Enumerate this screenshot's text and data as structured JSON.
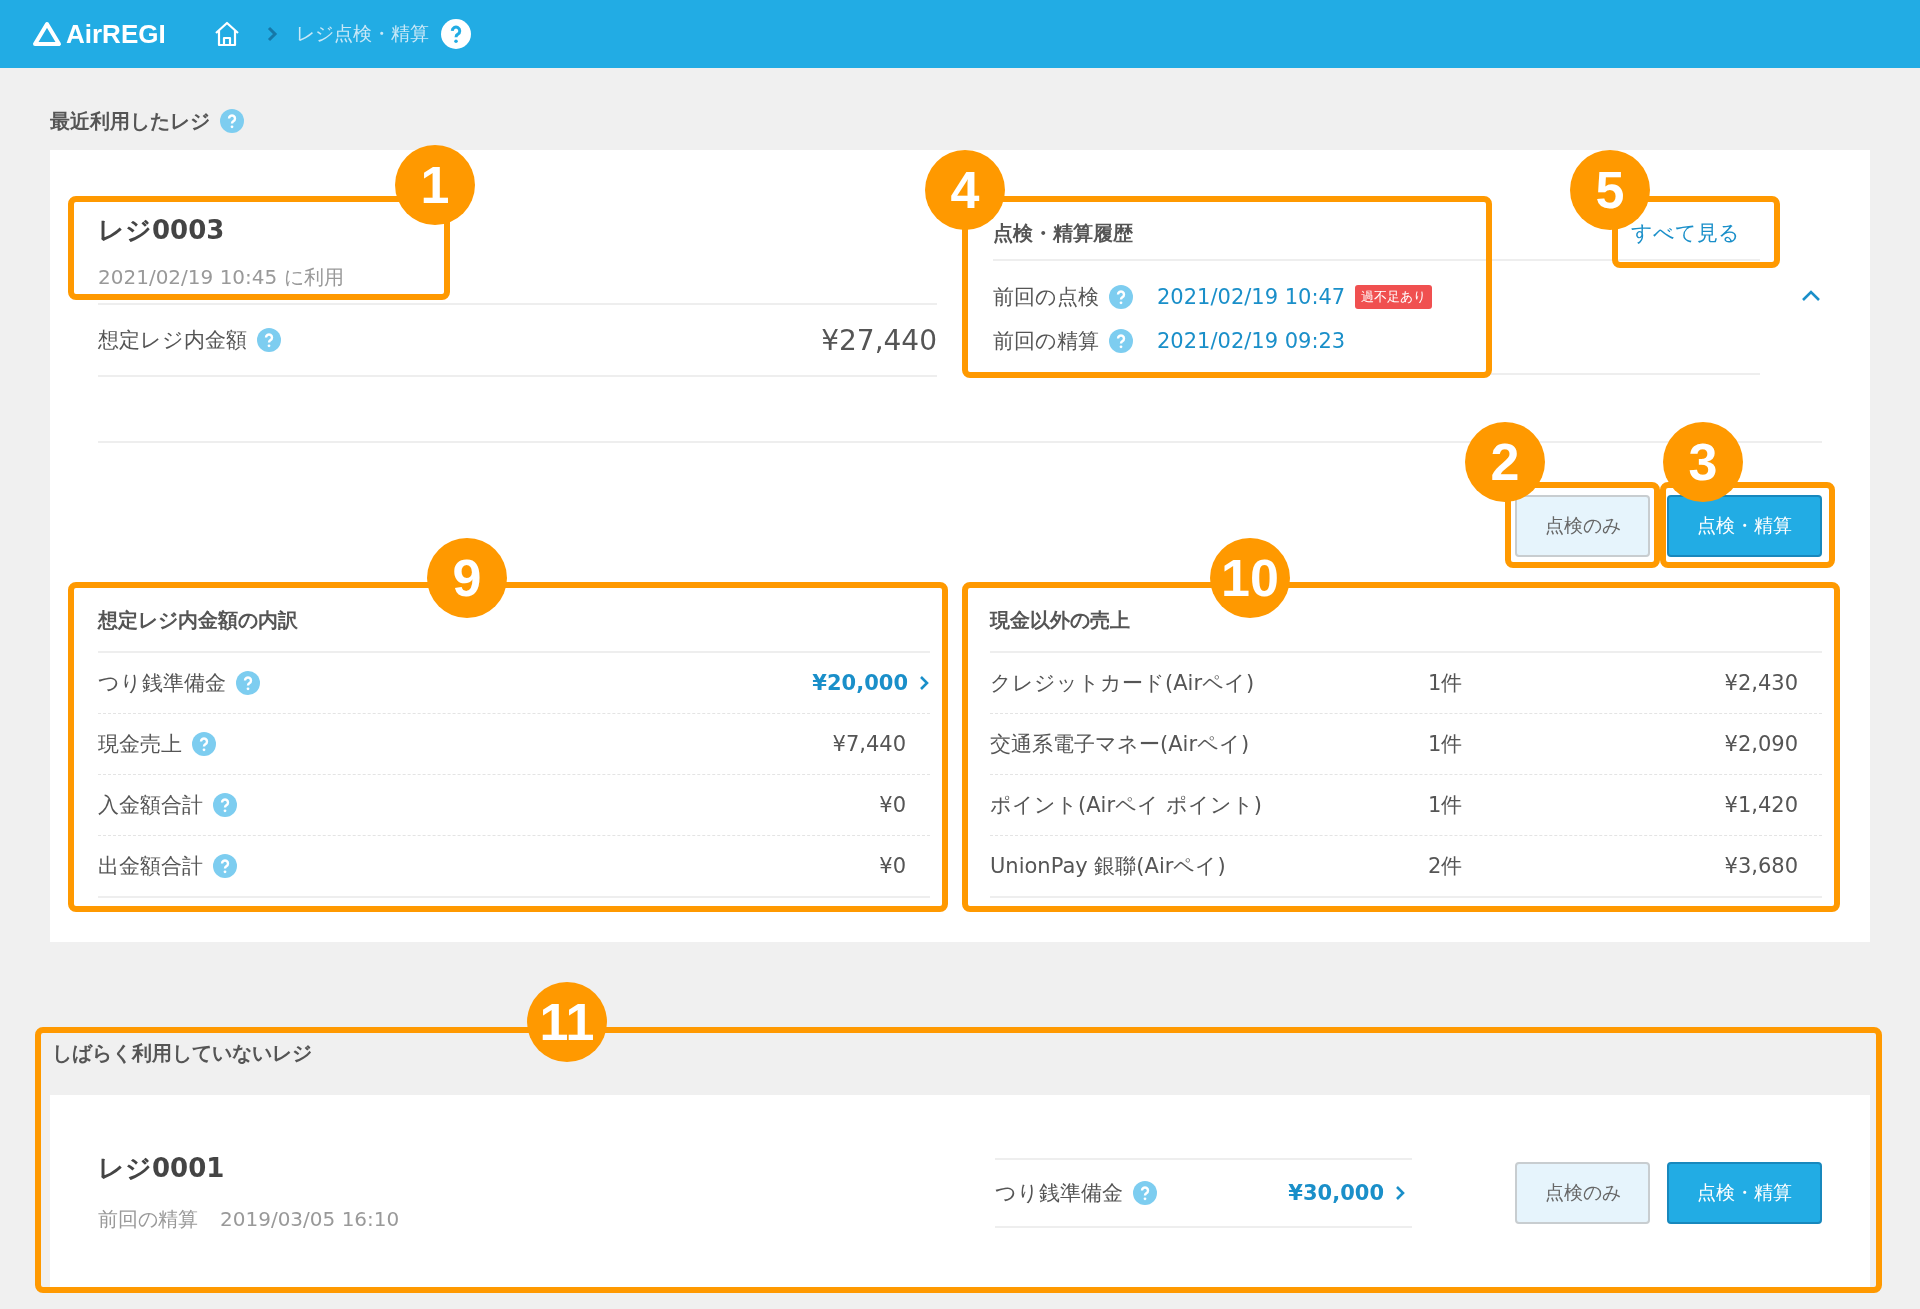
{
  "header": {
    "logo": "AirREGI",
    "breadcrumb": "レジ点検・精算"
  },
  "recent": {
    "title": "最近利用したレジ",
    "register": {
      "name": "レジ0003",
      "used_at": "2021/02/19 10:45 に利用",
      "expected_label": "想定レジ内金額",
      "expected_value": "¥27,440"
    },
    "history": {
      "title": "点検・精算履歴",
      "see_all": "すべて見る",
      "expanded": true,
      "rows": [
        {
          "label": "前回の点検",
          "value": "2021/02/19 10:47",
          "badge": "過不足あり"
        },
        {
          "label": "前回の精算",
          "value": "2021/02/19 09:23"
        }
      ]
    },
    "buttons": [
      {
        "label": "点検のみ",
        "kind": "secondary"
      },
      {
        "label": "点検・精算",
        "kind": "primary"
      }
    ],
    "breakdown": {
      "title": "想定レジ内金額の内訳",
      "rows": [
        {
          "label": "つり銭準備金",
          "value": "¥20,000",
          "link": true
        },
        {
          "label": "現金売上",
          "value": "¥7,440",
          "link": false
        },
        {
          "label": "入金額合計",
          "value": "¥0",
          "link": false
        },
        {
          "label": "出金額合計",
          "value": "¥0",
          "link": false
        }
      ]
    },
    "non_cash": {
      "title": "現金以外の売上",
      "rows": [
        {
          "label": "クレジットカード(Airペイ)",
          "count": "1件",
          "amount": "¥2,430"
        },
        {
          "label": "交通系電子マネー(Airペイ)",
          "count": "1件",
          "amount": "¥2,090"
        },
        {
          "label": "ポイント(Airペイ ポイント)",
          "count": "1件",
          "amount": "¥1,420"
        },
        {
          "label": "UnionPay 銀聯(Airペイ)",
          "count": "2件",
          "amount": "¥3,680"
        }
      ]
    }
  },
  "idle": {
    "title": "しばらく利用していないレジ",
    "registers": [
      {
        "name": "レジ0001",
        "last_label": "前回の精算",
        "last_value": "2019/03/05 16:10",
        "float_label": "つり銭準備金",
        "float_value": "¥30,000",
        "buttons": [
          {
            "label": "点検のみ",
            "kind": "secondary"
          },
          {
            "label": "点検・精算",
            "kind": "primary"
          }
        ]
      }
    ]
  },
  "annotations": [
    {
      "number": "1"
    },
    {
      "number": "4"
    },
    {
      "number": "5"
    },
    {
      "number": "2"
    },
    {
      "number": "3"
    },
    {
      "number": "9"
    },
    {
      "number": "10"
    },
    {
      "number": "11"
    }
  ]
}
